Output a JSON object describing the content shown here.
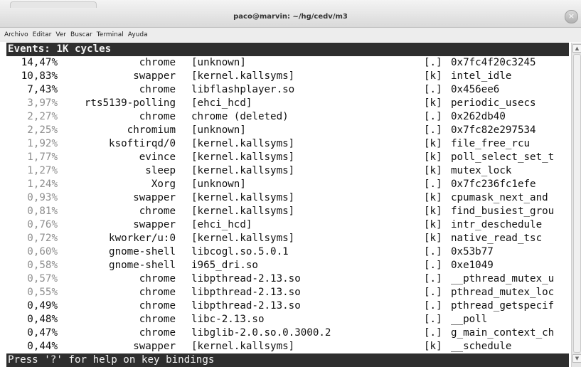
{
  "window": {
    "title": "paco@marvin: ~/hg/cedv/m3",
    "close_glyph": "×"
  },
  "menu": [
    "Archivo",
    "Editar",
    "Ver",
    "Buscar",
    "Terminal",
    "Ayuda"
  ],
  "perf": {
    "header": "Events: 1K cycles",
    "footer": "Press '?' for help on key bindings",
    "rows": [
      {
        "pct": "14,47%",
        "cmd": "chrome",
        "dso": "[unknown]",
        "lvl": "[.]",
        "sym": "0x7fc4f20c3245",
        "dim": false
      },
      {
        "pct": "10,83%",
        "cmd": "swapper",
        "dso": "[kernel.kallsyms]",
        "lvl": "[k]",
        "sym": "intel_idle",
        "dim": false
      },
      {
        "pct": "7,43%",
        "cmd": "chrome",
        "dso": "libflashplayer.so",
        "lvl": "[.]",
        "sym": "0x456ee6",
        "dim": false
      },
      {
        "pct": "3,97%",
        "cmd": "rts5139-polling",
        "dso": "[ehci_hcd]",
        "lvl": "[k]",
        "sym": "periodic_usecs",
        "dim": true
      },
      {
        "pct": "2,27%",
        "cmd": "chrome",
        "dso": "chrome (deleted)",
        "lvl": "[.]",
        "sym": "0x262db40",
        "dim": true
      },
      {
        "pct": "2,25%",
        "cmd": "chromium",
        "dso": "[unknown]",
        "lvl": "[.]",
        "sym": "0x7fc82e297534",
        "dim": true
      },
      {
        "pct": "1,92%",
        "cmd": "ksoftirqd/0",
        "dso": "[kernel.kallsyms]",
        "lvl": "[k]",
        "sym": "file_free_rcu",
        "dim": true
      },
      {
        "pct": "1,77%",
        "cmd": "evince",
        "dso": "[kernel.kallsyms]",
        "lvl": "[k]",
        "sym": "poll_select_set_t",
        "dim": true
      },
      {
        "pct": "1,27%",
        "cmd": "sleep",
        "dso": "[kernel.kallsyms]",
        "lvl": "[k]",
        "sym": "mutex_lock",
        "dim": true
      },
      {
        "pct": "1,24%",
        "cmd": "Xorg",
        "dso": "[unknown]",
        "lvl": "[.]",
        "sym": "0x7fc236fc1efe",
        "dim": true
      },
      {
        "pct": "0,93%",
        "cmd": "swapper",
        "dso": "[kernel.kallsyms]",
        "lvl": "[k]",
        "sym": "cpumask_next_and",
        "dim": true
      },
      {
        "pct": "0,81%",
        "cmd": "chrome",
        "dso": "[kernel.kallsyms]",
        "lvl": "[k]",
        "sym": "find_busiest_grou",
        "dim": true
      },
      {
        "pct": "0,76%",
        "cmd": "swapper",
        "dso": "[ehci_hcd]",
        "lvl": "[k]",
        "sym": "intr_deschedule",
        "dim": true
      },
      {
        "pct": "0,72%",
        "cmd": "kworker/u:0",
        "dso": "[kernel.kallsyms]",
        "lvl": "[k]",
        "sym": "native_read_tsc",
        "dim": true
      },
      {
        "pct": "0,60%",
        "cmd": "gnome-shell",
        "dso": "libcogl.so.5.0.1",
        "lvl": "[.]",
        "sym": "0x53b77",
        "dim": true
      },
      {
        "pct": "0,58%",
        "cmd": "gnome-shell",
        "dso": "i965_dri.so",
        "lvl": "[.]",
        "sym": "0xe1049",
        "dim": true
      },
      {
        "pct": "0,57%",
        "cmd": "chrome",
        "dso": "libpthread-2.13.so",
        "lvl": "[.]",
        "sym": "__pthread_mutex_u",
        "dim": true
      },
      {
        "pct": "0,55%",
        "cmd": "chrome",
        "dso": "libpthread-2.13.so",
        "lvl": "[.]",
        "sym": "pthread_mutex_loc",
        "dim": true
      },
      {
        "pct": "0,49%",
        "cmd": "chrome",
        "dso": "libpthread-2.13.so",
        "lvl": "[.]",
        "sym": "pthread_getspecif",
        "dim": false
      },
      {
        "pct": "0,48%",
        "cmd": "chrome",
        "dso": "libc-2.13.so",
        "lvl": "[.]",
        "sym": "__poll",
        "dim": false
      },
      {
        "pct": "0,47%",
        "cmd": "chrome",
        "dso": "libglib-2.0.so.0.3000.2",
        "lvl": "[.]",
        "sym": "g_main_context_ch",
        "dim": false
      },
      {
        "pct": "0,44%",
        "cmd": "swapper",
        "dso": "[kernel.kallsyms]",
        "lvl": "[k]",
        "sym": "__schedule",
        "dim": false
      }
    ]
  }
}
